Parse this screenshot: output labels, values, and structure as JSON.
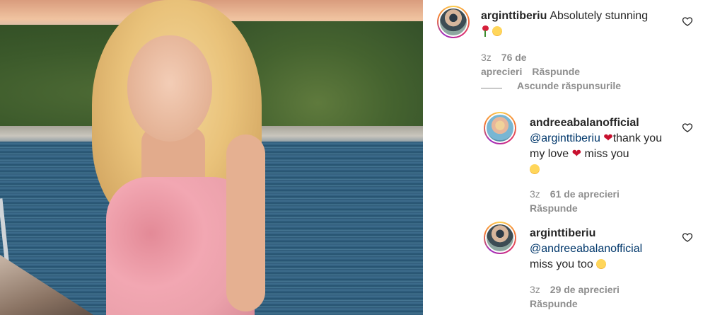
{
  "comments": [
    {
      "username": "arginttiberiu",
      "text": "Absolutely stunning",
      "emojis": [
        "rose",
        "kissing-face"
      ],
      "timestamp": "3z",
      "likes": "76 de aprecieri",
      "reply_label": "Răspunde",
      "avatar": "arginttiberiu-avatar"
    },
    {
      "username": "andreeabalanofficial",
      "mention": "@arginttiberiu",
      "text_part1": "thank you my love",
      "text_part2": "miss you",
      "emojis": [
        "heart",
        "heart",
        "heart-eyes-face"
      ],
      "timestamp": "3z",
      "likes": "61 de aprecieri",
      "reply_label": "Răspunde",
      "avatar": "andreeabalanofficial-avatar"
    },
    {
      "username": "arginttiberiu",
      "mention": "@andreeabalanofficial",
      "text": "miss you too",
      "emojis": [
        "kissing-face"
      ],
      "timestamp": "3z",
      "likes": "29 de aprecieri",
      "reply_label": "Răspunde",
      "avatar": "arginttiberiu-avatar"
    }
  ],
  "hide_replies_label": "Ascunde răspunsurile",
  "colors": {
    "text": "#262626",
    "meta": "#8e8e8e",
    "mention": "#00376b",
    "heart": "#c8102e"
  },
  "icons": {
    "like": "heart-outline-icon"
  }
}
